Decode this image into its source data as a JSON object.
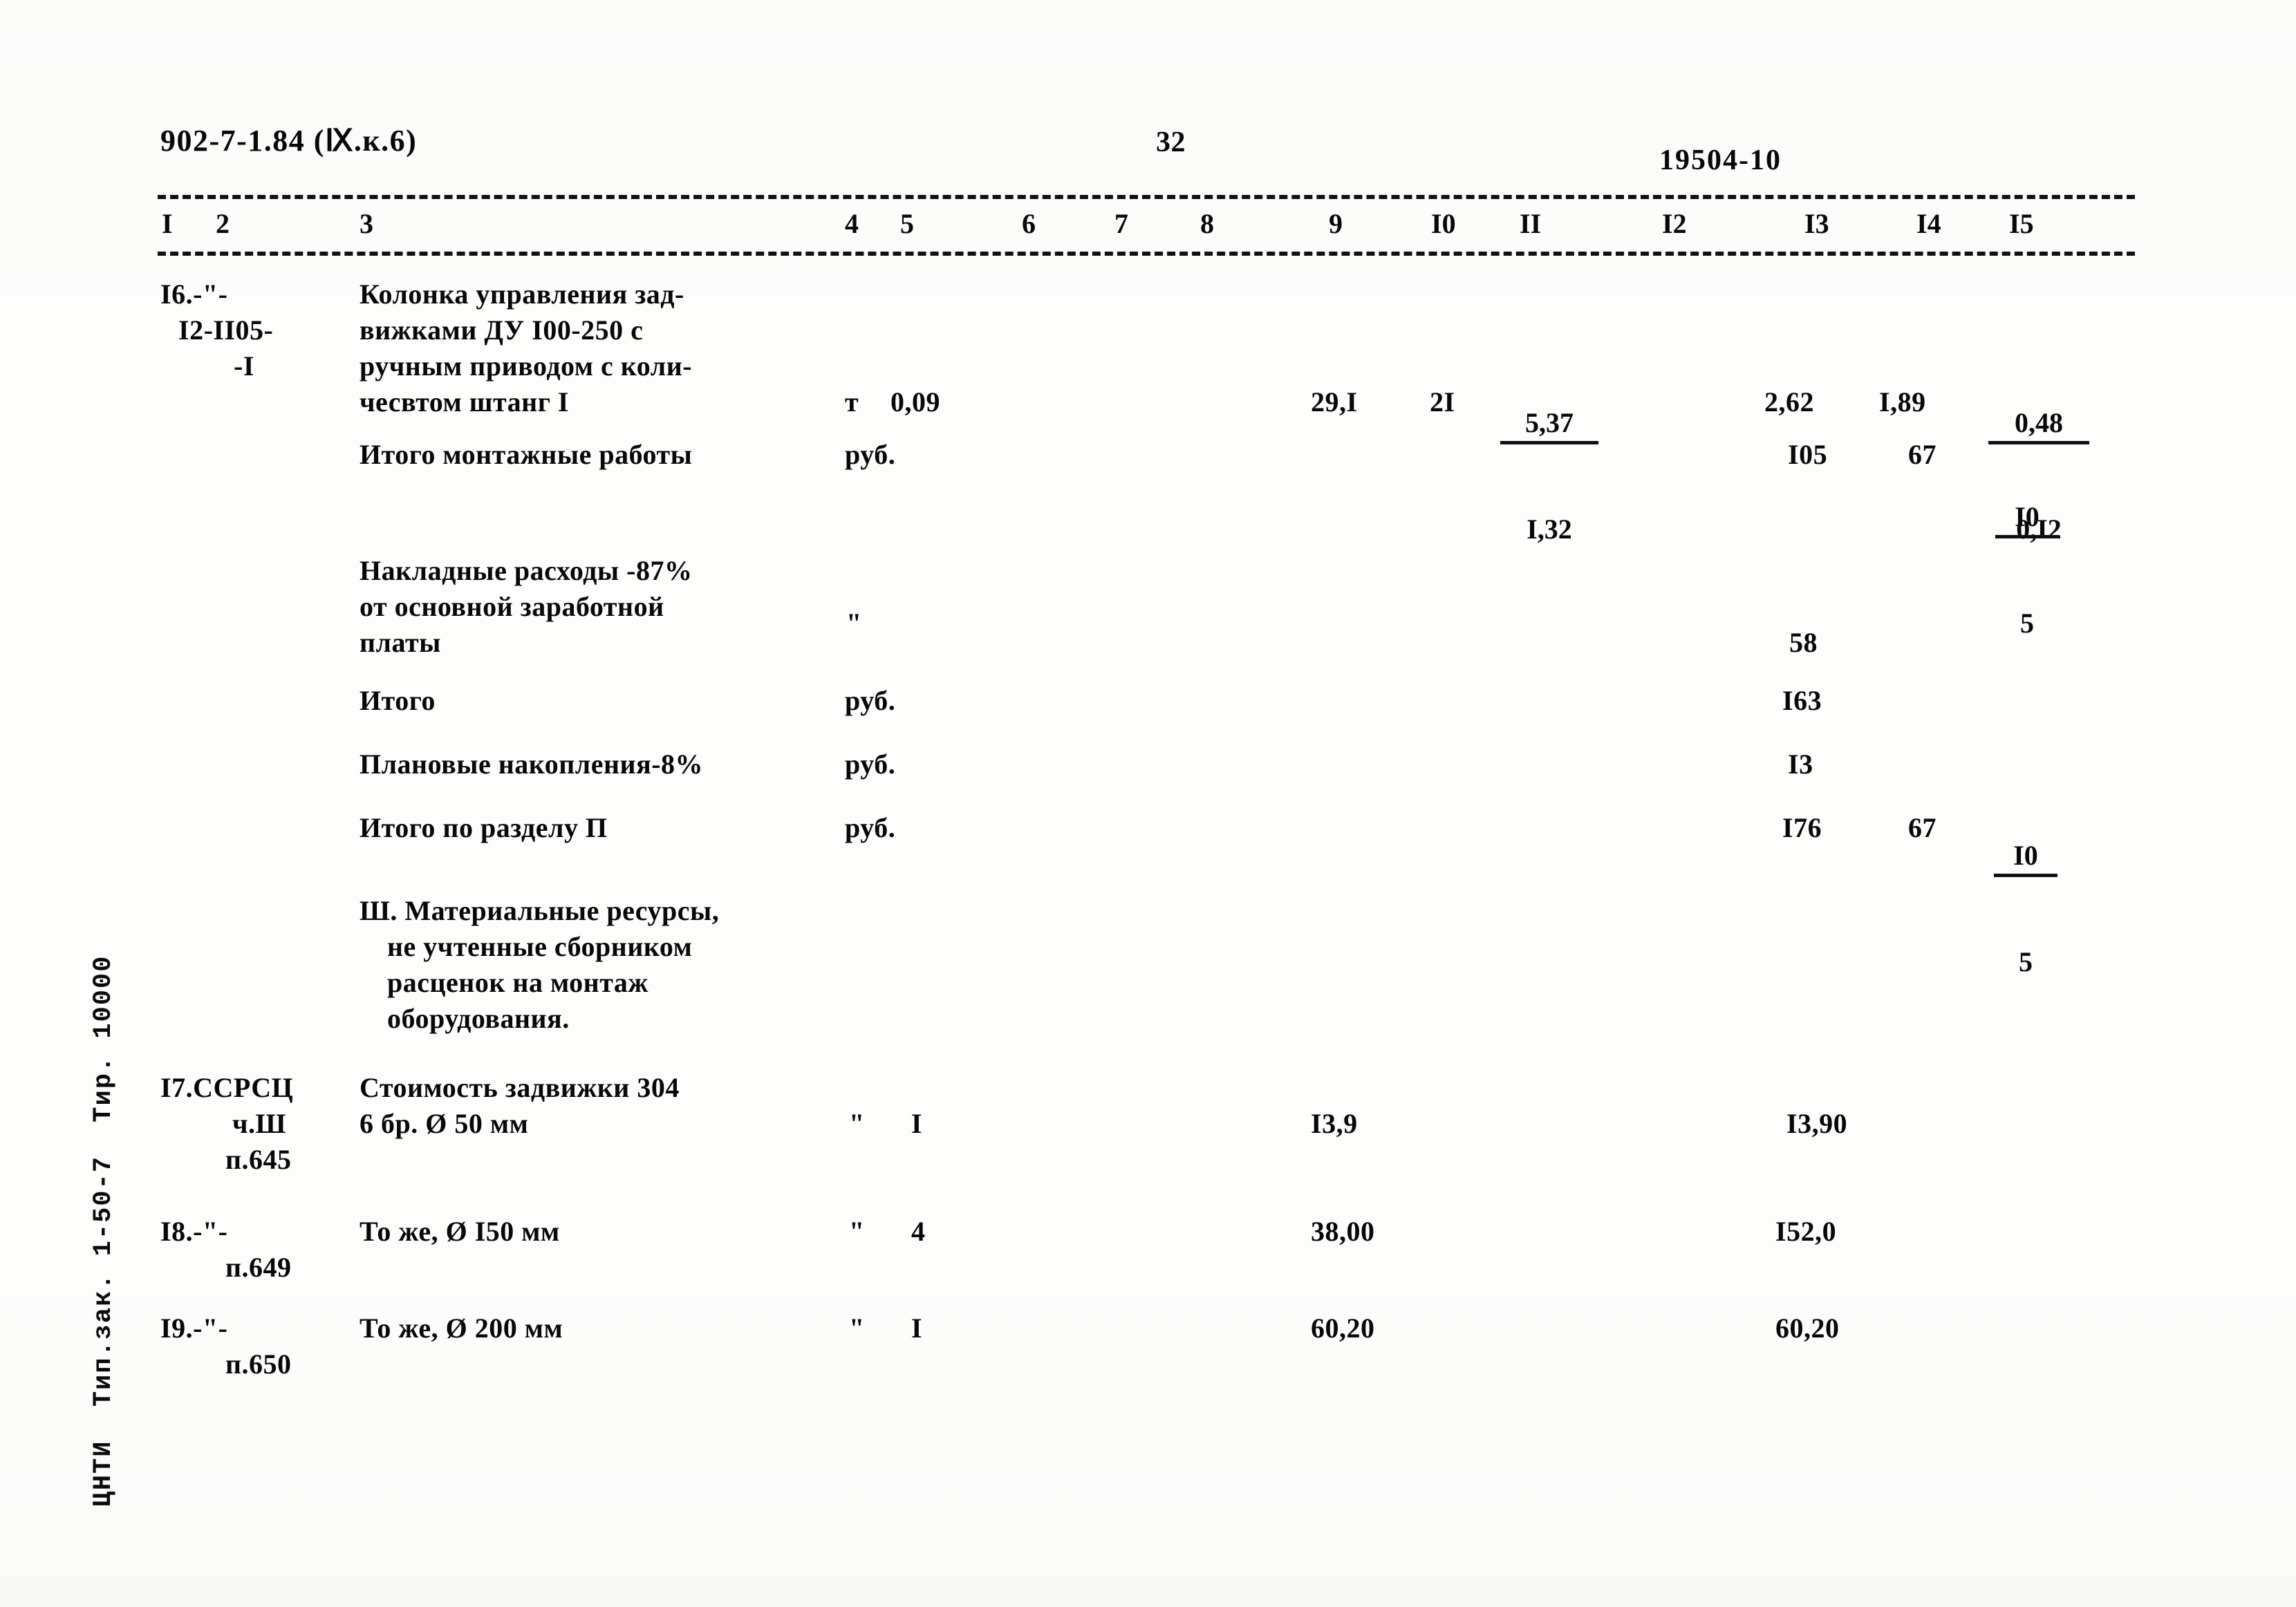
{
  "header": {
    "document_code": "902-7-1.84 (Ⅸ.к.6)",
    "page_number": "32",
    "sheet_code": "19504-10"
  },
  "columns": [
    {
      "id": "1",
      "label": "I"
    },
    {
      "id": "2",
      "label": "2"
    },
    {
      "id": "3",
      "label": "3"
    },
    {
      "id": "4",
      "label": "4"
    },
    {
      "id": "5",
      "label": "5"
    },
    {
      "id": "6",
      "label": "6"
    },
    {
      "id": "7",
      "label": "7"
    },
    {
      "id": "8",
      "label": "8"
    },
    {
      "id": "9",
      "label": "9"
    },
    {
      "id": "10",
      "label": "I0"
    },
    {
      "id": "11",
      "label": "II"
    },
    {
      "id": "12",
      "label": "I2"
    },
    {
      "id": "13",
      "label": "I3"
    },
    {
      "id": "14",
      "label": "I4"
    },
    {
      "id": "15",
      "label": "I5"
    }
  ],
  "rows": {
    "row16": {
      "number": "I6.-\"-",
      "code_line2": "I2-II05-",
      "code_line3": "-I",
      "description_l1": "Колонка управления зад-",
      "description_l2": "вижками ДУ I00-250 с",
      "description_l3": "ручным приводом с коли-",
      "description_l4": "чесвтом штанг I",
      "unit": "т",
      "quantity": "0,09",
      "col9": "29,I",
      "col10": "2I",
      "col11_top": "5,37",
      "col11_bottom": "I,32",
      "col13": "2,62",
      "col14": "I,89",
      "col15_top": "0,48",
      "col15_bottom": "0,I2"
    },
    "total_install": {
      "description": "Итого монтажные работы",
      "unit": "руб.",
      "col13": "I05",
      "col14": "67",
      "col15_top": "I0",
      "col15_bottom": "5"
    },
    "overhead": {
      "description_l1": "Накладные расходы -87%",
      "description_l2": "от основной заработной",
      "description_l3": "платы",
      "unit": "\"",
      "col13": "58"
    },
    "subtotal": {
      "description": "Итого",
      "unit": "руб.",
      "col13": "I63"
    },
    "planned_savings": {
      "description": "Плановые накопления-8%",
      "unit": "руб.",
      "col13": "I3"
    },
    "section_total": {
      "description": "Итого по разделу П",
      "unit": "руб.",
      "col13": "I76",
      "col14": "67",
      "col15_top": "I0",
      "col15_bottom": "5"
    },
    "section3_heading": {
      "line1": "Ш. Материальные ресурсы,",
      "line2": "не учтенные сборником",
      "line3": "расценок на монтаж",
      "line4": "оборудования."
    },
    "row17": {
      "number": "I7.ССРСЦ",
      "code_line2": "ч.Ш",
      "code_line3": "п.645",
      "description_l1": "Стоимость задвижки 304",
      "description_l2": "6 бр. Ø 50 мм",
      "unit": "\"",
      "quantity": "I",
      "col9": "I3,9",
      "col13": "I3,90"
    },
    "row18": {
      "number": "I8.-\"-",
      "code_line2": "п.649",
      "description_l1": "То же, Ø I50 мм",
      "unit": "\"",
      "quantity": "4",
      "col9": "38,00",
      "col13": "I52,0"
    },
    "row19": {
      "number": "I9.-\"-",
      "code_line2": "п.650",
      "description_l1": "То же, Ø 200 мм",
      "unit": "\"",
      "quantity": "I",
      "col9": "60,20",
      "col13": "60,20"
    }
  },
  "footer": {
    "imprint": "ЦНТИ  Тип.зак. 1-50-7  Тир. 10000"
  }
}
